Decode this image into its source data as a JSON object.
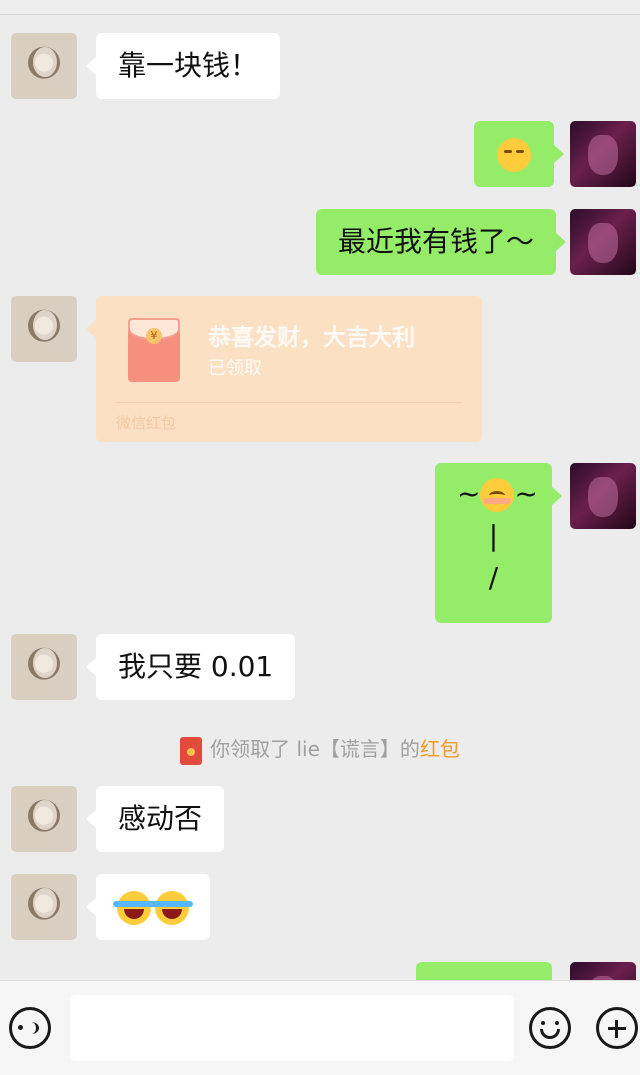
{
  "messages": {
    "m1": {
      "text": "靠一块钱！"
    },
    "m2": {
      "emoji": "smirk-emoji"
    },
    "m3": {
      "text": "最近我有钱了～"
    },
    "m4": {
      "red_packet_title": "恭喜发财，大吉大利",
      "red_packet_status": "已领取",
      "red_packet_footer": "微信红包"
    },
    "m5": {
      "line1_pre": "~",
      "line1_post": "~",
      "line2": "|",
      "line3": "/",
      "emoji": "blush-emoji"
    },
    "m6": {
      "text": "我只要 0.01"
    },
    "system": {
      "prefix": "你领取了 lie【谎言】的",
      "link": "红包"
    },
    "m7": {
      "text": "感动否"
    },
    "m8": {
      "emoji": "tears-of-joy-emoji x2"
    }
  },
  "colors": {
    "outgoing_bubble": "#95ec69",
    "incoming_bubble": "#ffffff",
    "background": "#ececec",
    "red_packet": "#fbe0c4",
    "link": "#f39a2f"
  },
  "input_bar": {
    "icons": [
      "voice-icon",
      "emoji-icon",
      "plus-icon"
    ]
  }
}
